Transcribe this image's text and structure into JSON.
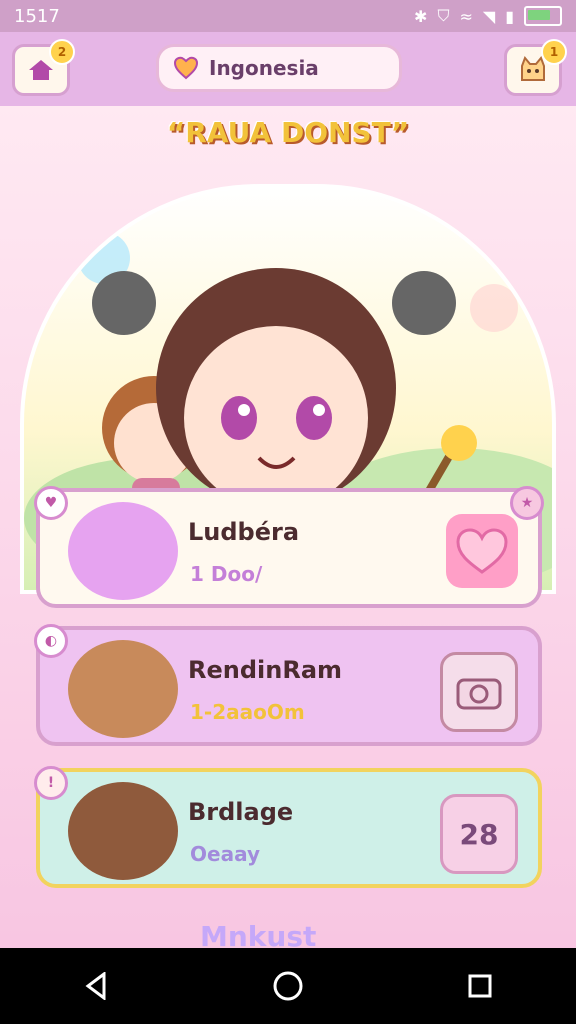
{
  "status": {
    "time": "1517"
  },
  "topbar": {
    "language": "Ingonesia",
    "home_badge": "2",
    "notify_badge": "1"
  },
  "hero": {
    "title": "“RAUA DONST”"
  },
  "cards": [
    {
      "name": "Ludbéra",
      "sub": "1 Doo/"
    },
    {
      "name": "RendinRam",
      "sub": "1-2aaoOm"
    },
    {
      "name": "Brdlage",
      "sub": "Oeaay",
      "action": "28"
    }
  ],
  "footer": {
    "label": "Mnkust"
  },
  "colors": {
    "accent": "#d8a0ce",
    "gold": "#f2c23a",
    "pink": "#f7c8e0"
  },
  "icons": [
    "home-icon",
    "heart-pill-icon",
    "cat-icon",
    "heart-icon",
    "camera-icon",
    "star-icon",
    "back-icon",
    "circle-home-icon",
    "square-icon"
  ]
}
